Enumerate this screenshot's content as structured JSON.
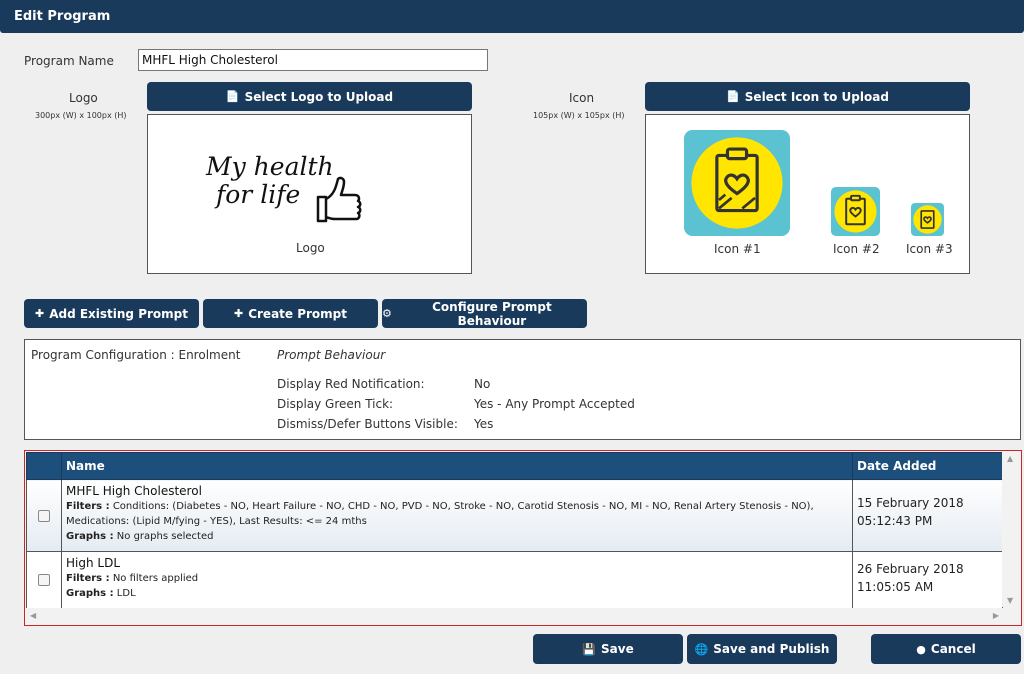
{
  "window": {
    "title": "Edit Program"
  },
  "program": {
    "name_label": "Program Name",
    "name_value": "MHFL High Cholesterol"
  },
  "logo": {
    "label": "Logo",
    "size_hint": "300px (W) x 100px (H)",
    "upload_label": "Select Logo to Upload",
    "text_line1": "My health",
    "text_line2": "for life",
    "caption": "Logo"
  },
  "icon": {
    "label": "Icon",
    "size_hint": "105px (W) x 105px (H)",
    "upload_label": "Select Icon to Upload",
    "captions": [
      "Icon #1",
      "Icon #2",
      "Icon #3"
    ],
    "colors": {
      "tile": "#5bc2d2",
      "circle": "#ffe500",
      "line": "#333333"
    }
  },
  "toolbar": {
    "add_existing": "Add Existing Prompt",
    "create": "Create Prompt",
    "configure": "Configure Prompt Behaviour"
  },
  "config": {
    "title": "Program Configuration : Enrolment",
    "section": "Prompt Behaviour",
    "rows": [
      {
        "label": "Display Red Notification:",
        "value": "No"
      },
      {
        "label": "Display Green Tick:",
        "value": "Yes - Any Prompt Accepted"
      },
      {
        "label": "Dismiss/Defer Buttons Visible:",
        "value": "Yes"
      }
    ]
  },
  "table": {
    "headers": {
      "name": "Name",
      "date": "Date Added"
    },
    "rows": [
      {
        "name": "MHFL High Cholesterol",
        "filters_label": "Filters :",
        "filters": "Conditions: (Diabetes - NO, Heart Failure - NO, CHD - NO, PVD - NO, Stroke - NO, Carotid Stenosis - NO, MI - NO, Renal Artery Stenosis - NO),",
        "filters2": "Medications: (Lipid M/fying - YES), Last Results: <= 24 mths",
        "graphs_label": "Graphs :",
        "graphs": "No graphs selected",
        "date": "15 February 2018",
        "time": "05:12:43 PM"
      },
      {
        "name": "High LDL",
        "filters_label": "Filters :",
        "filters": "No filters applied",
        "graphs_label": "Graphs :",
        "graphs": "LDL",
        "date": "26 February 2018",
        "time": "11:05:05 AM"
      }
    ]
  },
  "footer": {
    "save": "Save",
    "save_publish": "Save and Publish",
    "cancel": "Cancel"
  }
}
